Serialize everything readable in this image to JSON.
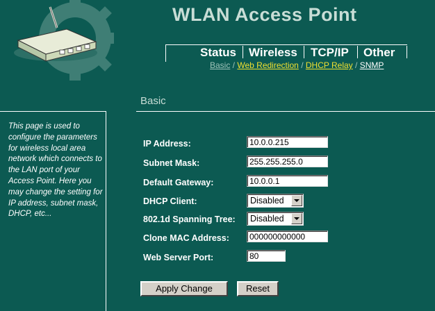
{
  "header": {
    "title": "WLAN Access Point",
    "tabs": [
      {
        "id": "status",
        "label": "Status"
      },
      {
        "id": "wireless",
        "label": "Wireless"
      },
      {
        "id": "tcpip",
        "label": "TCP/IP"
      },
      {
        "id": "other",
        "label": "Other"
      }
    ],
    "subnav": [
      {
        "label": "Basic",
        "color": "#9fc3b9"
      },
      {
        "label": "Web Redirection",
        "color": "#f0e030"
      },
      {
        "label": "DHCP Relay",
        "color": "#f0e030"
      },
      {
        "label": "SNMP",
        "color": "#ffffff"
      }
    ],
    "subnav_separator": " / "
  },
  "section_title": "Basic",
  "description": "This page is used to configure the parameters for wireless local area network which connects to the LAN port of your Access Point. Here you may change the setting for IP address, subnet mask, DHCP, etc...",
  "form": {
    "ip_address": {
      "label": "IP Address:",
      "value": "10.0.0.215"
    },
    "subnet_mask": {
      "label": "Subnet Mask:",
      "value": "255.255.255.0"
    },
    "default_gateway": {
      "label": "Default Gateway:",
      "value": "10.0.0.1"
    },
    "dhcp_client": {
      "label": "DHCP Client:",
      "value": "Disabled"
    },
    "spanning_tree": {
      "label": "802.1d Spanning Tree:",
      "value": "Disabled"
    },
    "clone_mac": {
      "label": "Clone MAC Address:",
      "value": "000000000000"
    },
    "web_server_port": {
      "label": "Web Server Port:",
      "value": "80"
    }
  },
  "buttons": {
    "apply_label": "Apply Change",
    "reset_label": "Reset"
  },
  "colors": {
    "background": "#0c5a52",
    "title_text": "#c8ddd6",
    "link_yellow": "#f0e030"
  },
  "icons": {
    "logo": "router-icon"
  }
}
